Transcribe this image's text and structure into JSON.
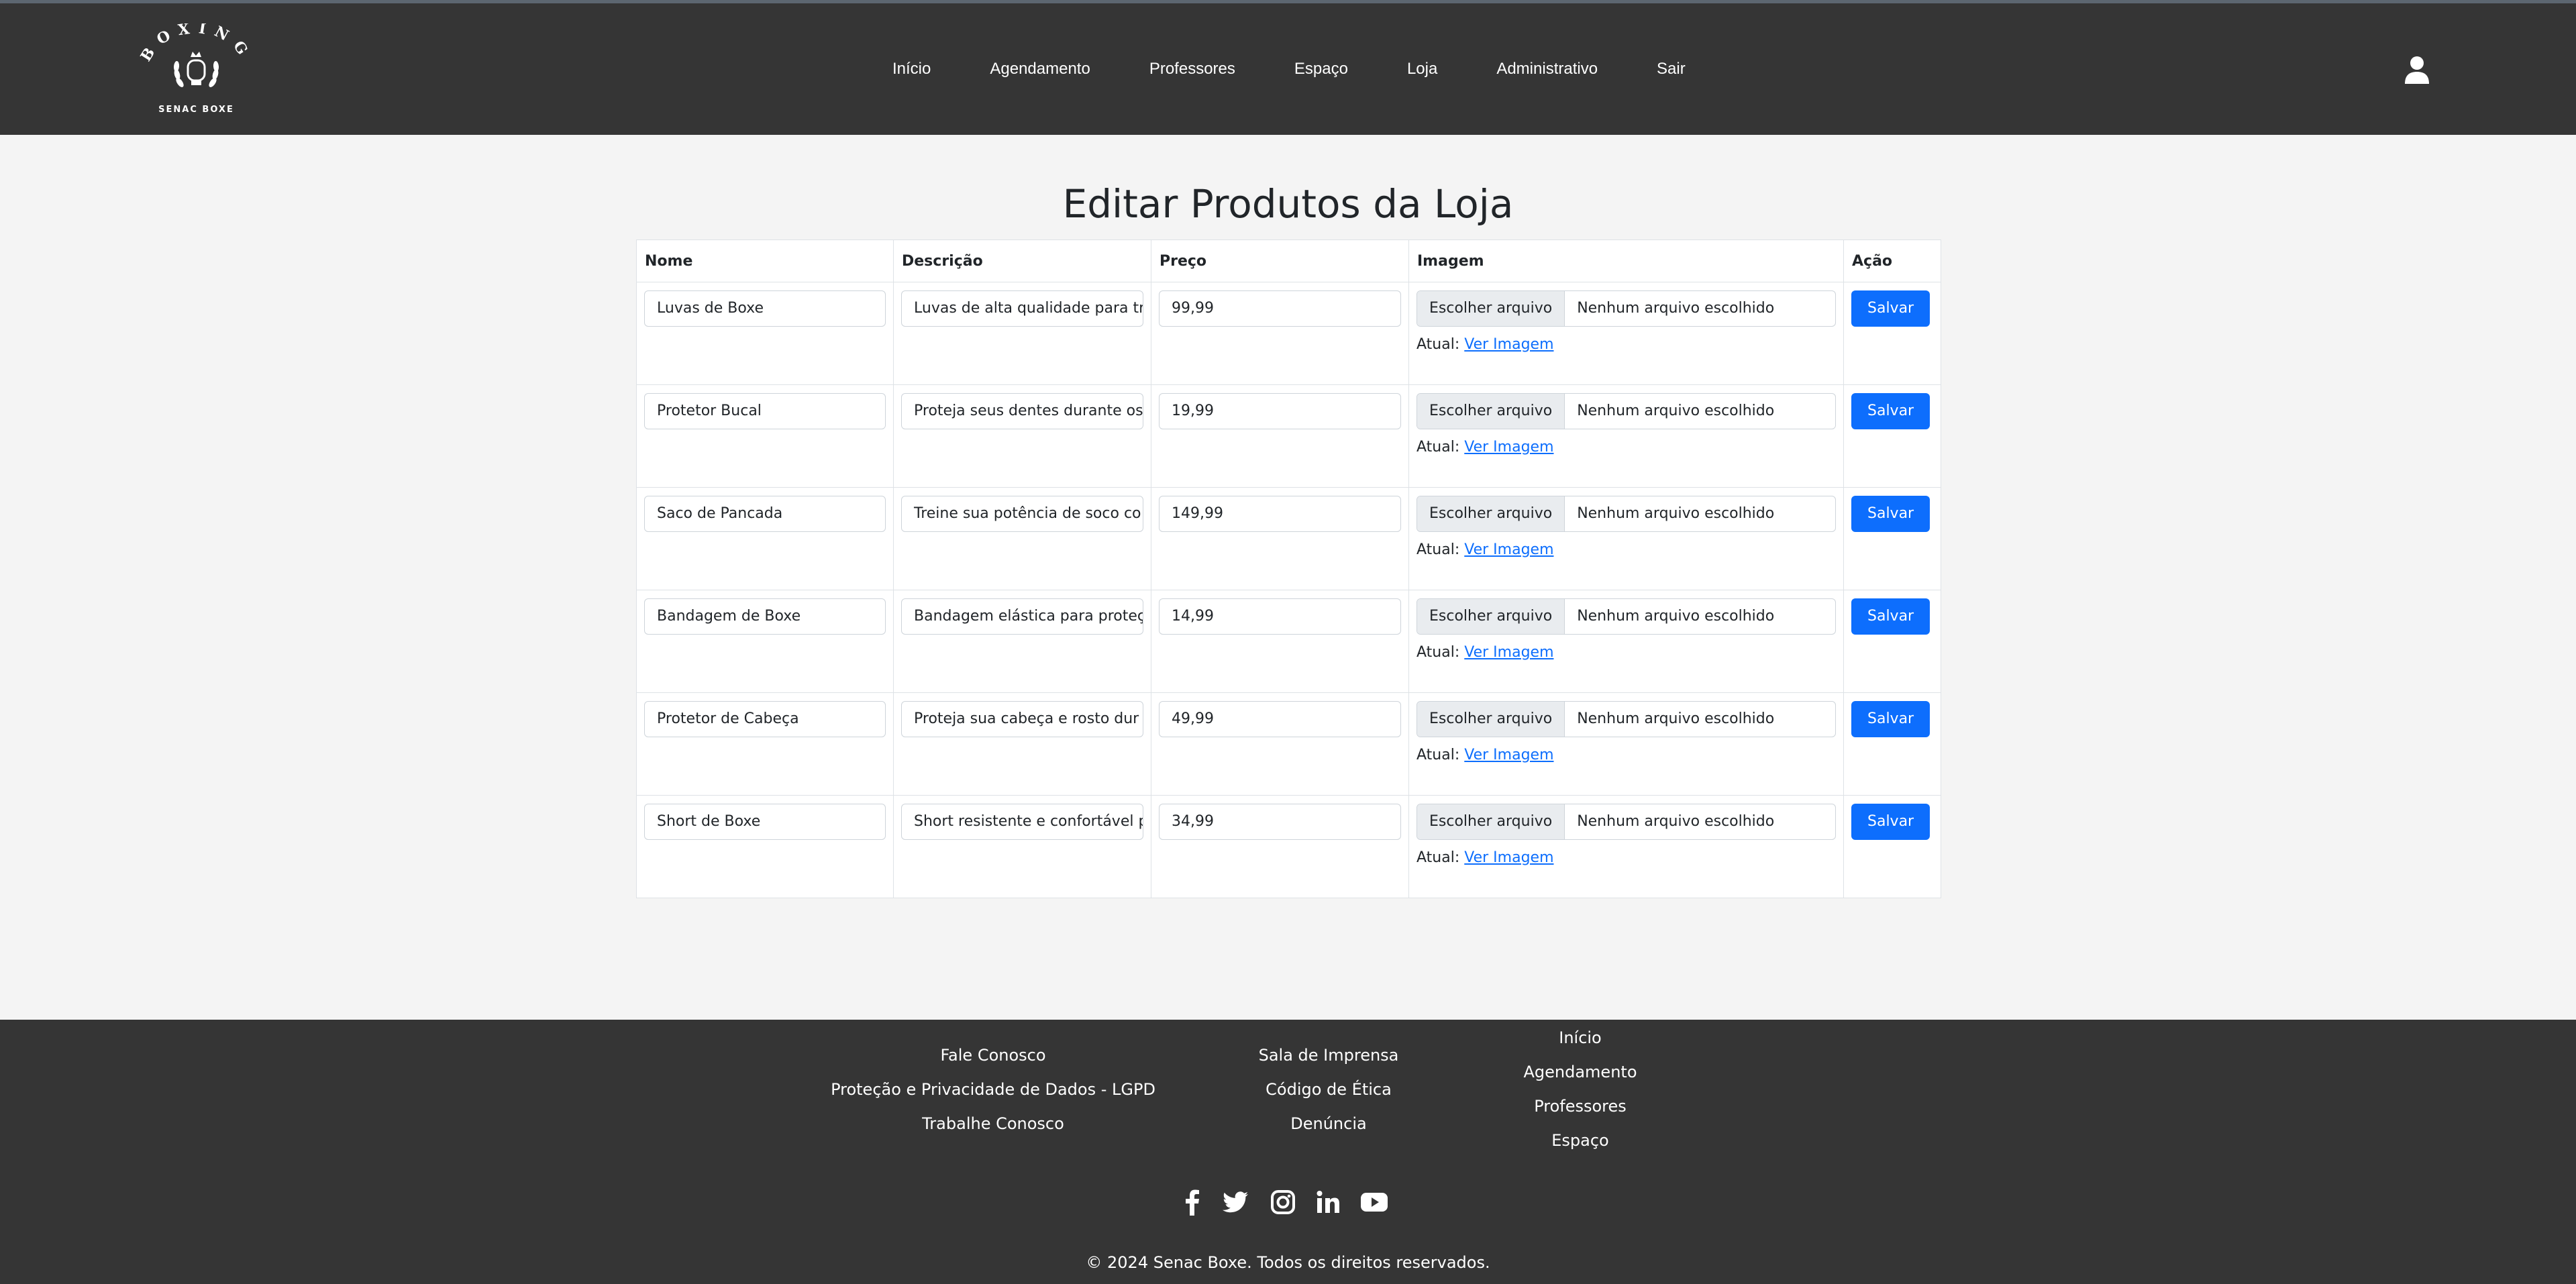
{
  "brand": {
    "logo_top_text": "BOXING",
    "logo_bottom_text": "SENAC BOXE"
  },
  "nav": {
    "items": [
      "Início",
      "Agendamento",
      "Professores",
      "Espaço",
      "Loja",
      "Administrativo",
      "Sair"
    ]
  },
  "page": {
    "title": "Editar Produtos da Loja"
  },
  "table": {
    "headers": [
      "Nome",
      "Descrição",
      "Preço",
      "Imagem",
      "Ação"
    ],
    "file_button_label": "Escolher arquivo",
    "file_status": "Nenhum arquivo escolhido",
    "current_label": "Atual:",
    "view_image_label": "Ver Imagem",
    "save_label": "Salvar",
    "rows": [
      {
        "name": "Luvas de Boxe",
        "description": "Luvas de alta qualidade para tr",
        "price": "99,99"
      },
      {
        "name": "Protetor Bucal",
        "description": "Proteja seus dentes durante os",
        "price": "19,99"
      },
      {
        "name": "Saco de Pancada",
        "description": "Treine sua potência de soco co",
        "price": "149,99"
      },
      {
        "name": "Bandagem de Boxe",
        "description": "Bandagem elástica para proteç",
        "price": "14,99"
      },
      {
        "name": "Protetor de Cabeça",
        "description": "Proteja sua cabeça e rosto dur",
        "price": "49,99"
      },
      {
        "name": "Short de Boxe",
        "description": "Short resistente e confortável p",
        "price": "34,99"
      }
    ]
  },
  "footer": {
    "col1": [
      "Fale Conosco",
      "Proteção e Privacidade de Dados - LGPD",
      "Trabalhe Conosco"
    ],
    "col2": [
      "Sala de Imprensa",
      "Código de Ética",
      "Denúncia"
    ],
    "col3": [
      "Início",
      "Agendamento",
      "Professores",
      "Espaço"
    ],
    "social_icons": [
      "facebook-icon",
      "twitter-icon",
      "instagram-icon",
      "linkedin-icon",
      "youtube-icon"
    ],
    "copyright": "© 2024 Senac Boxe. Todos os direitos reservados."
  },
  "colors": {
    "header_bg": "#353535",
    "page_bg": "#f4f4f4",
    "primary": "#0d6efd"
  }
}
